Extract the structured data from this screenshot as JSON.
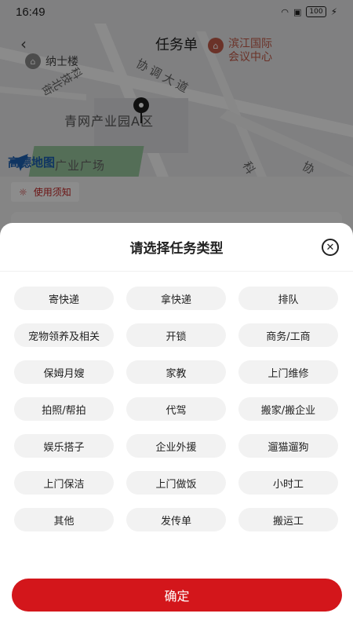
{
  "status_bar": {
    "time": "16:49",
    "battery": "100"
  },
  "header": {
    "title": "任务单"
  },
  "map": {
    "labels": {
      "naishilou": "纳士楼",
      "binjiang_line1": "滨江国际",
      "binjiang_line2": "会议中心",
      "kejibeijie": "科技北街",
      "xietiao": "协调大道",
      "qingwang": "青网产业园A区",
      "guangchang": "广业广场",
      "xie2": "协",
      "ke2": "科"
    },
    "logo": "高德地图"
  },
  "notice": {
    "label": "使用须知"
  },
  "sheet": {
    "title": "请选择任务类型",
    "options": [
      "寄快递",
      "拿快递",
      "排队",
      "宠物领养及相关",
      "开锁",
      "商务/工商",
      "保姆月嫂",
      "家教",
      "上门维修",
      "拍照/帮拍",
      "代驾",
      "搬家/搬企业",
      "娱乐搭子",
      "企业外援",
      "遛猫遛狗",
      "上门保洁",
      "上门做饭",
      "小时工",
      "其他",
      "发传单",
      "搬运工"
    ],
    "confirm_label": "确定"
  },
  "icons": {
    "close": "close-icon",
    "back": "back-arrow-icon",
    "pin": "location-pin-icon",
    "bulb": "lightbulb-icon"
  },
  "colors": {
    "accent": "#d3161b"
  }
}
